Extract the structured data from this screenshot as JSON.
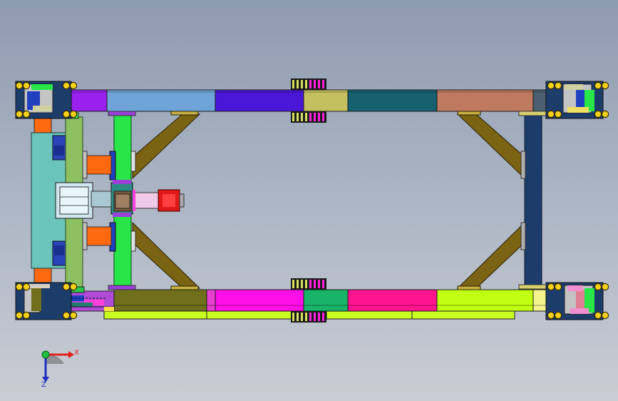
{
  "viewport": {
    "background_top": "#8e9bb0",
    "background_bottom": "#c9cdd4"
  },
  "triad": {
    "x_label": "X",
    "z_label": "Z",
    "x_color": "#e0201c",
    "z_color": "#2030c0",
    "origin_color": "#20c040"
  },
  "palette": {
    "outline": "#1a1a1a",
    "bearing_yellow": "#f5d21a",
    "magenta_rack": "#ff20e0",
    "teal_motor_housing": "#6cc5bd",
    "strut": "#7a6312",
    "right_beam": "#1c3c6a",
    "green_column": "#28e648",
    "light_green_column": "#8cc060",
    "orange_block": "#ff6a10"
  },
  "top_rail_colors": [
    "#9a20ee",
    "#6ea4d8",
    "#4a16d8",
    "#c4c060",
    "#166070",
    "#c07a60",
    "#4a6070"
  ],
  "bottom_rail_colors": [
    "#6f6f1c",
    "#ff10e8",
    "#18b468",
    "#ff1490",
    "#c0ff12",
    "#f4f48c"
  ],
  "lower_rail_color": "#c8ff20"
}
